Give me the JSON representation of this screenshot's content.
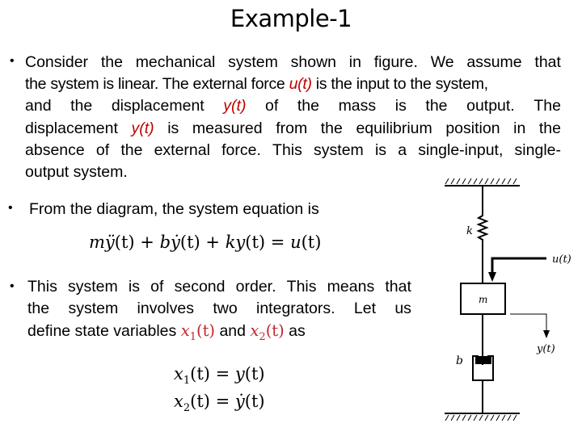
{
  "slide": {
    "title": "Example-1",
    "bullets": [
      {
        "marker": "•",
        "lines": [
          [
            "Consider",
            "the",
            "mechanical",
            "system",
            "shown",
            "in",
            "figure.",
            "We",
            "assume",
            "that"
          ],
          [
            "the system is linear. The external force ",
            "u(t)",
            " is the input to the system,"
          ],
          [
            "and",
            "the",
            "displacement",
            "y(t)",
            "of",
            "the",
            "mass",
            "is",
            "the",
            "output.",
            "The"
          ],
          [
            "displacement",
            "y(t)",
            "is",
            "measured",
            "from",
            "the",
            "equilibrium",
            "position",
            "in",
            "the"
          ],
          [
            "absence",
            "of",
            "the",
            "external",
            "force.",
            "This",
            "system",
            "is",
            "a",
            "single-input,",
            "single-"
          ],
          [
            "output system."
          ]
        ],
        "text": "Consider the mechanical system shown in figure. We assume that the system is linear. The external force u(t) is the input to the system, and the displacement y(t) of the mass is the output. The displacement y(t) is measured from the equilibrium position in the absence of the external force. This system is a single-input, single-output system."
      },
      {
        "marker": "•",
        "text": "From the diagram, the system equation is"
      },
      {
        "marker": "•",
        "line1": [
          "This",
          "system",
          "is",
          "of",
          "second",
          "order.",
          "This",
          "means",
          "that"
        ],
        "line2": [
          "the",
          "system",
          "involves",
          "two",
          "integrators.",
          "Let",
          "us"
        ],
        "line3_prefix": "define state variables ",
        "line3_var1": "x",
        "line3_var1_sub": "1",
        "line3_var1_arg": "(t)",
        "line3_mid": " and ",
        "line3_var2": "x",
        "line3_var2_sub": "2",
        "line3_var2_arg": "(t)",
        "line3_suffix": " as"
      }
    ],
    "equation_main": {
      "m": "m",
      "yddot": "ÿ",
      "t1": "(t)",
      "plus1": " + ",
      "b": "b",
      "ydot": "ẏ",
      "t2": "(t)",
      "plus2": " + ",
      "k": "k",
      "y": "y",
      "t3": "(t)",
      "eq": " = ",
      "u": "u",
      "t4": "(t)"
    },
    "state_equations": [
      {
        "lhs": "x",
        "sub": "1",
        "arg": "(t)",
        "eq": " = ",
        "rhs": "y",
        "rhs_arg": "(t)"
      },
      {
        "lhs": "x",
        "sub": "2",
        "arg": "(t)",
        "eq": " = ",
        "rhs": "ẏ",
        "rhs_arg": "(t)"
      }
    ],
    "diagram": {
      "spring_label": "k",
      "mass_label": "m",
      "damper_label": "b",
      "input_label": "u(t)",
      "output_label": "y(t)"
    },
    "colors": {
      "highlight_text": "#c00000",
      "highlight_math": "#c0272d"
    }
  }
}
